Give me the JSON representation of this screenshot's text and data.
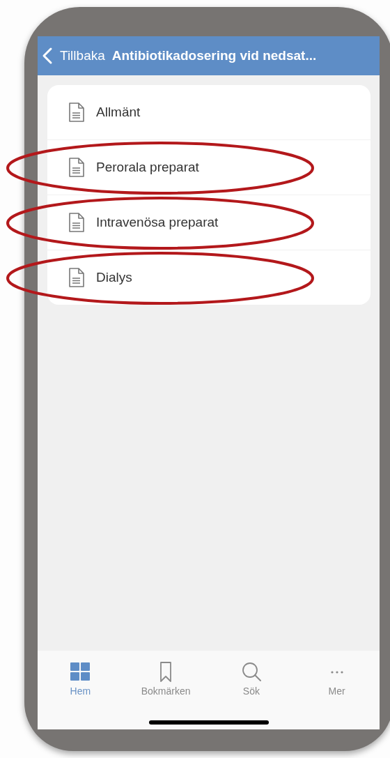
{
  "header": {
    "back_label": "Tillbaka",
    "title": "Antibiotikadosering vid nedsat..."
  },
  "items": [
    {
      "label": "Allmänt",
      "circled": false
    },
    {
      "label": "Perorala preparat",
      "circled": true
    },
    {
      "label": "Intravenösa preparat",
      "circled": true
    },
    {
      "label": "Dialys",
      "circled": true
    }
  ],
  "tab_bar": [
    {
      "label": "Hem",
      "kind": "grid",
      "selected": true
    },
    {
      "label": "Bokmärken",
      "kind": "bookmark",
      "selected": false
    },
    {
      "label": "Sök",
      "kind": "search",
      "selected": false
    },
    {
      "label": "Mer",
      "kind": "more",
      "selected": false
    }
  ]
}
